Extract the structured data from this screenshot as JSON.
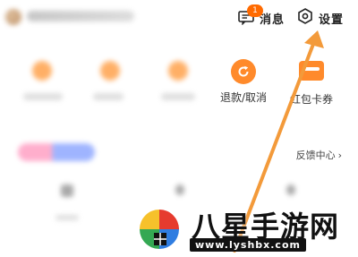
{
  "header": {
    "messages_label": "消息",
    "messages_badge": "1",
    "settings_label": "设置"
  },
  "services": {
    "refund_label": "退款/取消",
    "redpacket_label": "红包卡券"
  },
  "feedback": {
    "label": "反馈中心",
    "chevron": "›"
  },
  "watermark": {
    "title": "八星手游网",
    "url": "www.lyshbx.com"
  },
  "colors": {
    "accent_orange": "#ff8a2b",
    "badge": "#ff6a00",
    "arrow": "#f39a3a"
  }
}
